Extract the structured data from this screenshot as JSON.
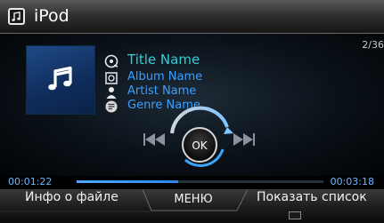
{
  "header": {
    "title": "iPod",
    "icon": "music-note-icon"
  },
  "track": {
    "count": "2/36",
    "title": "Title Name",
    "album": "Album Name",
    "artist": "Artist Name",
    "genre": "Genre Name"
  },
  "controls": {
    "ok_label": "OK"
  },
  "playback": {
    "elapsed": "00:01:22",
    "total": "00:03:18",
    "progress_fraction": 0.41
  },
  "bottom_bar": {
    "file_info_label": "Инфо о файле",
    "menu_label": "МЕНЮ",
    "show_list_label": "Показать список"
  },
  "colors": {
    "title_text": "#33ccd6",
    "meta_text": "#3aa0ff",
    "time_text": "#6fb6ff",
    "cover_bg": "#1f4a86"
  }
}
